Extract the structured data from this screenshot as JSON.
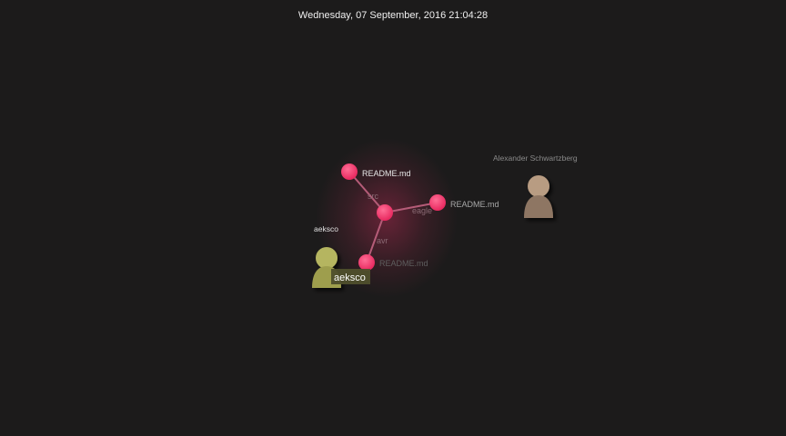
{
  "timestamp": "Wednesday, 07 September, 2016 21:04:28",
  "colors": {
    "background": "#1c1b1b",
    "file_node": "#f0326a",
    "edge": "#b55c78",
    "user_aeksco": "#b5b560",
    "user_alexander": "#b89c82"
  },
  "files": [
    {
      "label": "README.md"
    },
    {
      "label": "README.md"
    },
    {
      "label": "README.md"
    }
  ],
  "directories": [
    {
      "label": "src"
    },
    {
      "label": "eagle"
    },
    {
      "label": "avr"
    }
  ],
  "users": [
    {
      "name": "aeksco",
      "tag": "aeksco",
      "icon": "person-icon"
    },
    {
      "name": "Alexander Schwartzberg",
      "icon": "person-icon"
    }
  ]
}
